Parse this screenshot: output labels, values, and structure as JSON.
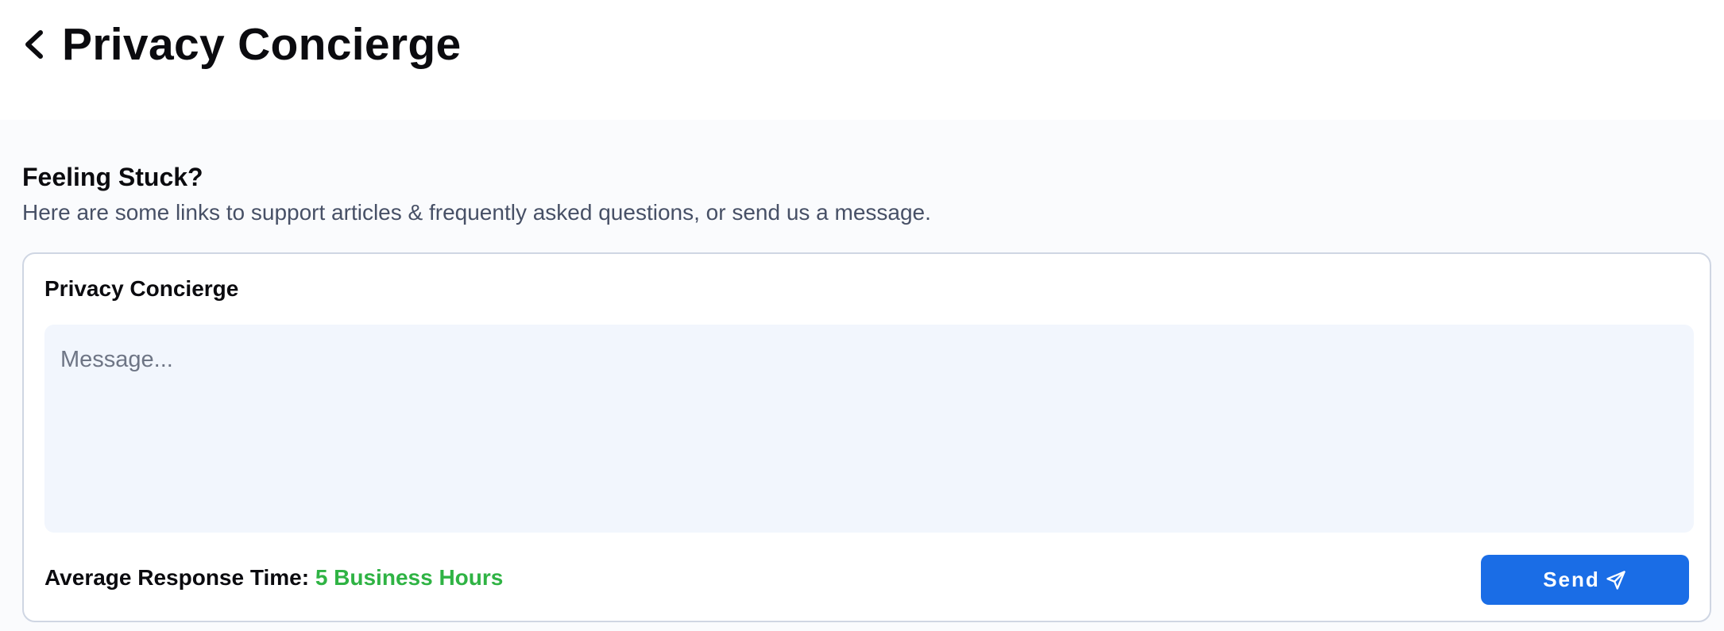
{
  "header": {
    "title": "Privacy Concierge",
    "back_icon": "chevron-left-icon"
  },
  "help": {
    "heading": "Feeling Stuck?",
    "subtitle": "Here are some links to support articles & frequently asked questions, or send us a message."
  },
  "card": {
    "title": "Privacy Concierge",
    "message": {
      "value": "",
      "placeholder": "Message..."
    },
    "response_time": {
      "label": "Average Response Time:",
      "value": "5 Business Hours",
      "value_color": "#2fb344"
    },
    "send": {
      "label": "Send",
      "icon": "paper-plane-icon",
      "color": "#1a6de6"
    }
  }
}
